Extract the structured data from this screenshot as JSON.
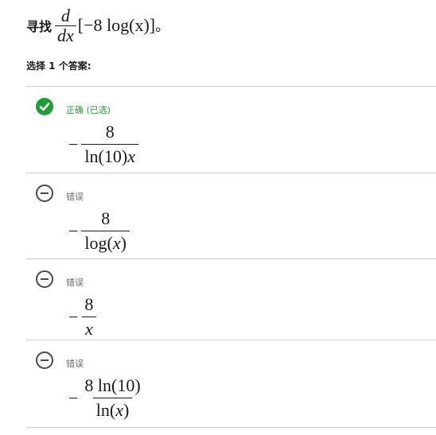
{
  "question": {
    "prefix": "寻找",
    "d_numerator": "d",
    "d_denominator": "dx",
    "expression": "[−8 log(x)]",
    "suffix": "。"
  },
  "instruction": "选择 1 个答案:",
  "choices": [
    {
      "status": "correct",
      "icon": "checkmark-icon",
      "label": "正确 (已选)",
      "minus": "−",
      "numerator": "8",
      "denominator_text": "ln(10)",
      "denominator_var": "x"
    },
    {
      "status": "incorrect",
      "icon": "minus-circle-icon",
      "label": "错误",
      "minus": "−",
      "numerator": "8",
      "denominator_text": "log(",
      "denominator_var": "x",
      "denominator_tail": ")"
    },
    {
      "status": "incorrect",
      "icon": "minus-circle-icon",
      "label": "错误",
      "minus": "−",
      "numerator": "8",
      "denominator_var": "x"
    },
    {
      "status": "incorrect",
      "icon": "minus-circle-icon",
      "label": "错误",
      "minus": "−",
      "numerator": "8 ln(10)",
      "denominator_text": "ln(",
      "denominator_var": "x",
      "denominator_tail": ")"
    }
  ],
  "colors": {
    "correct": "#1f9e36",
    "divider": "#cccccc",
    "text": "#1a1a1a"
  }
}
